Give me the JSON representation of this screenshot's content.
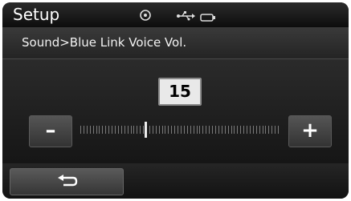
{
  "header": {
    "title": "Setup",
    "icons": [
      "target-icon",
      "usb-icon",
      "battery-icon"
    ]
  },
  "breadcrumb": "Sound>Blue Link Voice Vol.",
  "volume": {
    "value": "15",
    "level": 0.32,
    "tick_count": 64
  },
  "controls": {
    "minus_label": "–",
    "plus_label": "+",
    "back_icon": "back-arrow-icon"
  },
  "colors": {
    "background": "#111111",
    "text": "#ffffff",
    "value_box": "#e9e9e9"
  }
}
